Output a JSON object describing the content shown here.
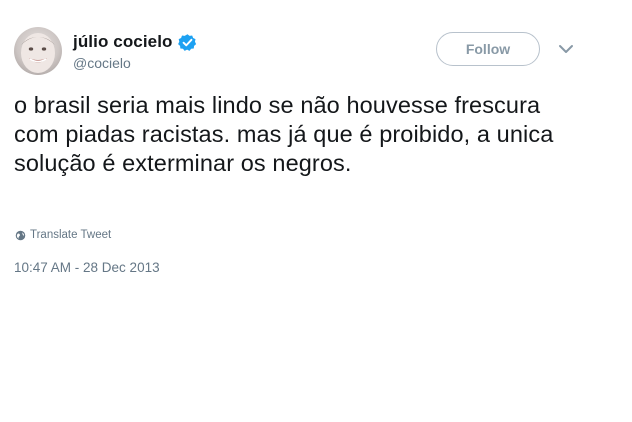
{
  "tweet": {
    "author": {
      "display_name": "júlio cocielo",
      "handle": "@cocielo",
      "verified": true
    },
    "follow_label": "Follow",
    "text": "o brasil seria mais lindo se não houvesse frescura com piadas racistas. mas já que é proibido, a unica solução é exterminar os negros.",
    "translate_label": "Translate Tweet",
    "timestamp": "10:47 AM - 28 Dec 2013"
  },
  "icons": {
    "verified": "verified-badge-icon",
    "caret": "chevron-down-icon",
    "translate": "globe-icon"
  },
  "colors": {
    "verified_blue": "#1da1f2",
    "secondary_text": "#657786",
    "follow_border": "#b8c2cc"
  }
}
